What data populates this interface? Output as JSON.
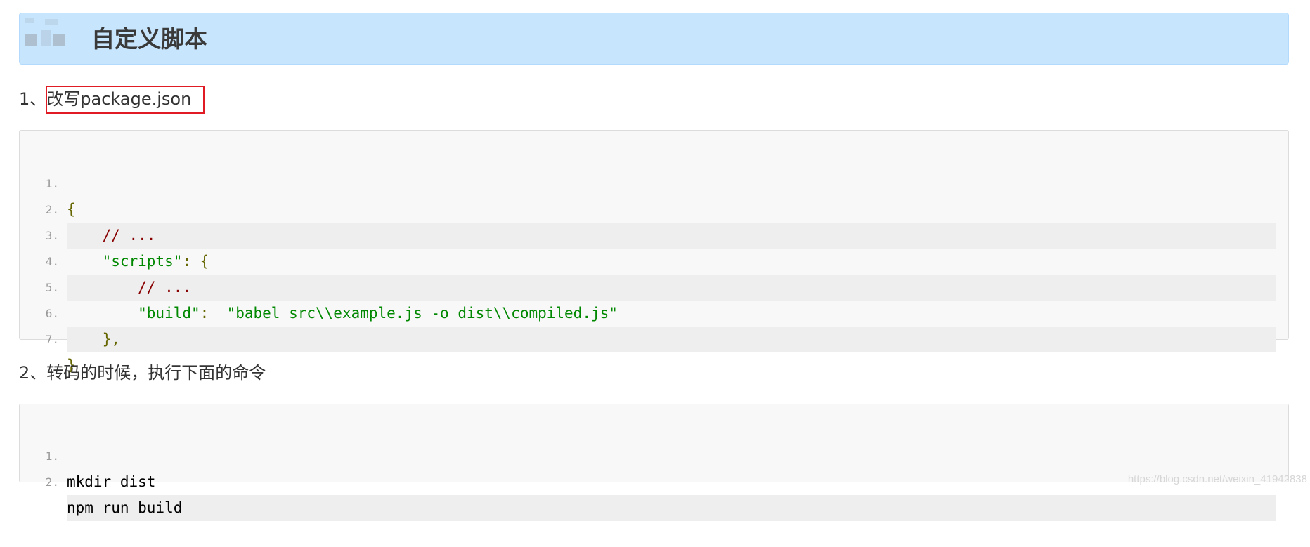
{
  "heading": {
    "title": "自定义脚本"
  },
  "para1": {
    "prefix": "1、",
    "highlight": "改写package.json"
  },
  "code1": {
    "lines": [
      {
        "num": "1.",
        "text": "{"
      },
      {
        "num": "2.",
        "text": "    // ..."
      },
      {
        "num": "3.",
        "text_a": "    \"scripts\"",
        "text_b": ": {"
      },
      {
        "num": "4.",
        "text": "        // ..."
      },
      {
        "num": "5.",
        "text_a": "        \"build\"",
        "text_b": ":  ",
        "text_c": "\"babel src\\\\example.js -o dist\\\\compiled.js\""
      },
      {
        "num": "6.",
        "text": "    },"
      },
      {
        "num": "7.",
        "text": "}"
      }
    ]
  },
  "para2": {
    "text": "2、转码的时候，执行下面的命令"
  },
  "code2": {
    "lines": [
      {
        "num": "1.",
        "text": "mkdir dist"
      },
      {
        "num": "2.",
        "text": "npm run build"
      }
    ]
  },
  "watermark": "https://blog.csdn.net/weixin_41942838",
  "colors": {
    "heading_bg": "#c7e5fd",
    "highlight_border": "#e01b24",
    "string": "#008800",
    "punctuation": "#666600"
  }
}
